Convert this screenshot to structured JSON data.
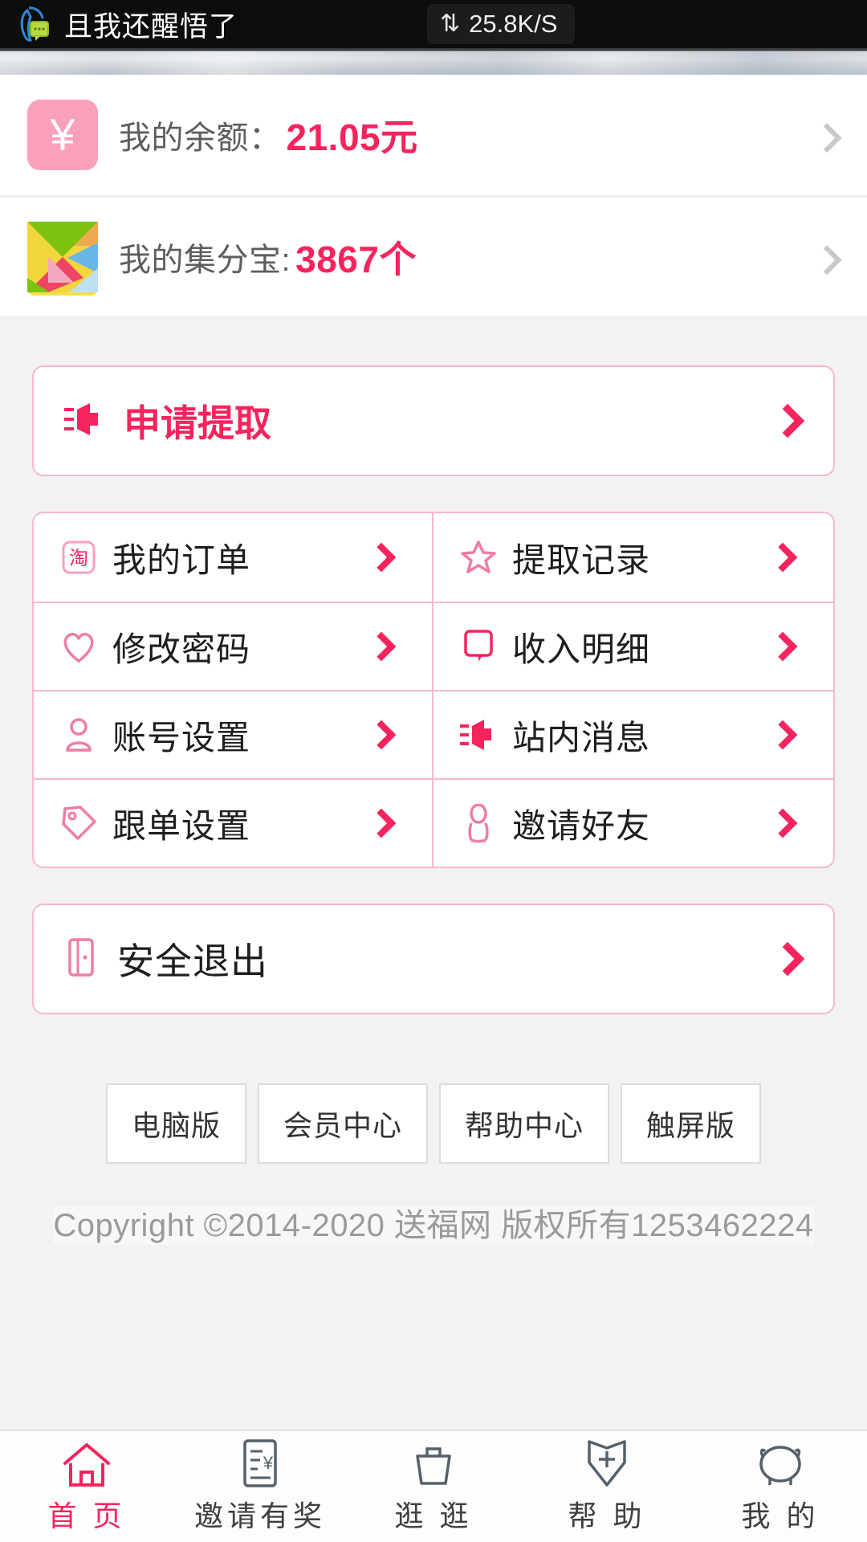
{
  "statusbar": {
    "app_name": "且我还醒悟了",
    "net_speed": "25.8K/S",
    "net_icon": "up-down-arrows-icon",
    "app_icon": "chat-bubble-icon"
  },
  "account": {
    "balance": {
      "icon": "yen-icon",
      "label": "我的余额：",
      "value": "21.05元"
    },
    "points": {
      "icon": "tangram-icon",
      "label": "我的集分宝:",
      "value": "3867个"
    }
  },
  "withdraw": {
    "icon": "megaphone-icon",
    "label": "申请提取"
  },
  "menu": [
    {
      "icon": "taobao-icon",
      "label": "我的订单"
    },
    {
      "icon": "star-icon",
      "label": "提取记录"
    },
    {
      "icon": "heart-icon",
      "label": "修改密码"
    },
    {
      "icon": "message-icon",
      "label": "收入明细"
    },
    {
      "icon": "user-icon",
      "label": "账号设置"
    },
    {
      "icon": "megaphone-icon",
      "label": "站内消息"
    },
    {
      "icon": "tag-icon",
      "label": "跟单设置"
    },
    {
      "icon": "person-icon",
      "label": "邀请好友"
    }
  ],
  "logout": {
    "icon": "door-exit-icon",
    "label": "安全退出"
  },
  "footer_links": [
    "电脑版",
    "会员中心",
    "帮助中心",
    "触屏版"
  ],
  "copyright": "Copyright ©2014-2020 送福网 版权所有1253462224",
  "tabbar": [
    {
      "icon": "home-icon",
      "label": "首 页",
      "active": true
    },
    {
      "icon": "invoice-icon",
      "label": "邀请有奖",
      "active": false
    },
    {
      "icon": "basket-icon",
      "label": "逛 逛",
      "active": false
    },
    {
      "icon": "help-icon",
      "label": "帮 助",
      "active": false
    },
    {
      "icon": "piggy-icon",
      "label": "我 的",
      "active": false
    }
  ],
  "colors": {
    "accent_pink": "#f5245d",
    "light_pink": "#f6b9cd",
    "icon_pink": "#f9a0bb",
    "page_bg": "#f2f2f2"
  }
}
